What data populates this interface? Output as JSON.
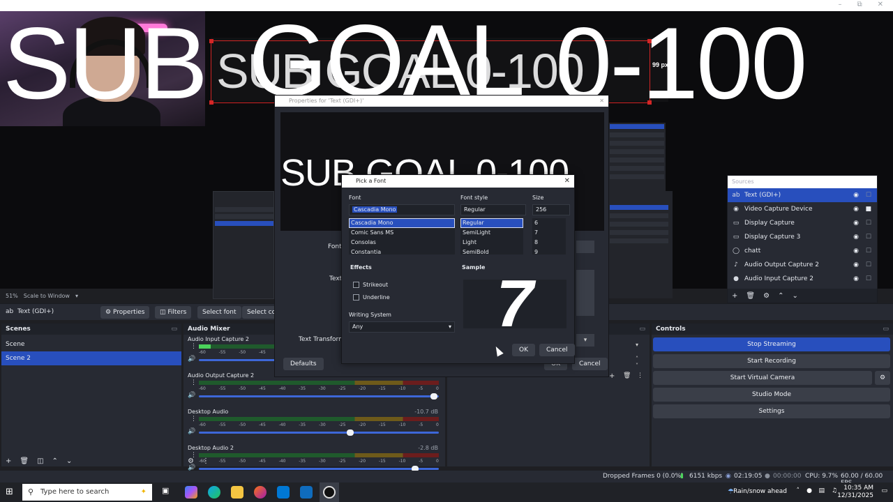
{
  "window": {
    "controls": [
      "–",
      "⧉",
      "✕"
    ]
  },
  "preview": {
    "overlay_words": [
      "SUB",
      "GOAL",
      "0-100"
    ],
    "nested_text": "SUB GOAL 0-100",
    "size_label": "99 px",
    "zoom": "51%",
    "scale_mode": "Scale to Window"
  },
  "sources": {
    "title": "Sources",
    "items": [
      {
        "label": "Text (GDI+)",
        "icon": "ab",
        "selected": true
      },
      {
        "label": "Video Capture Device",
        "icon": "camera"
      },
      {
        "label": "Display Capture",
        "icon": "monitor"
      },
      {
        "label": "Display Capture 3",
        "icon": "monitor"
      },
      {
        "label": "chatt",
        "icon": "globe"
      },
      {
        "label": "Audio Output Capture 2",
        "icon": "speaker"
      },
      {
        "label": "Audio Input Capture 2",
        "icon": "mic"
      }
    ]
  },
  "toolbar": {
    "source_name": "Text (GDI+)",
    "properties": "Properties",
    "filters": "Filters",
    "select_font": "Select font",
    "select_color": "Select colo"
  },
  "scenes": {
    "title": "Scenes",
    "items": [
      "Scene",
      "Scene 2"
    ]
  },
  "mixer": {
    "title": "Audio Mixer",
    "scale": [
      "-60",
      "-55",
      "-50",
      "-45",
      "-40",
      "-35",
      "-30",
      "-25",
      "-20",
      "-15",
      "-10",
      "-5",
      "0"
    ],
    "channels": [
      {
        "name": "Audio Input Capture 2",
        "db": "",
        "level": 0.05,
        "volume": 0.45
      },
      {
        "name": "Audio Output Capture 2",
        "db": "0.0 dB",
        "level": 0.0,
        "volume": 0.98
      },
      {
        "name": "Desktop Audio",
        "db": "-10.7 dB",
        "level": 0.0,
        "volume": 0.63
      },
      {
        "name": "Desktop Audio 2",
        "db": "-2.8 dB",
        "level": 0.0,
        "volume": 0.9
      }
    ]
  },
  "controls": {
    "title": "Controls",
    "stop_streaming": "Stop Streaming",
    "start_recording": "Start Recording",
    "start_virtual_camera": "Start Virtual Camera",
    "studio_mode": "Studio Mode",
    "settings": "Settings"
  },
  "properties_window": {
    "title": "Properties for 'Text (GDI+)'",
    "preview_text": "SUB GOAL 0-100",
    "font_label": "Font",
    "text_label": "Text",
    "transform_label": "Text Transform",
    "defaults": "Defaults",
    "ok": "OK",
    "cancel": "Cancel"
  },
  "font_dialog": {
    "title": "Pick a Font",
    "font_label": "Font",
    "font_value": "Cascadia Mono",
    "fonts": [
      "Cascadia Mono",
      "Comic Sans MS",
      "Consolas",
      "Constantia"
    ],
    "style_label": "Font style",
    "style_value": "Regular",
    "styles": [
      "Regular",
      "SemiLight",
      "Light",
      "SemiBold"
    ],
    "size_label": "Size",
    "size_value": "256",
    "sizes": [
      "6",
      "7",
      "8",
      "9"
    ],
    "effects_label": "Effects",
    "strikeout": "Strikeout",
    "underline": "Underline",
    "sample_label": "Sample",
    "sample_glyph": "7",
    "writing_label": "Writing System",
    "writing_value": "Any",
    "ok": "OK",
    "cancel": "Cancel"
  },
  "status": {
    "dropped": "Dropped Frames 0 (0.0%)",
    "kbps": "6151 kbps",
    "stream_time": "02:19:05",
    "rec_time": "00:00:00",
    "cpu": "CPU: 9.7%",
    "fps": "60.00 / 60.00 FPS"
  },
  "taskbar": {
    "search_placeholder": "Type here to search",
    "weather": "Rain/snow ahead",
    "time": "10:35 AM",
    "date": "12/31/2025"
  },
  "colors": {
    "accent": "#284fbd",
    "bg": "#1e1f23",
    "panel": "#272a33"
  }
}
